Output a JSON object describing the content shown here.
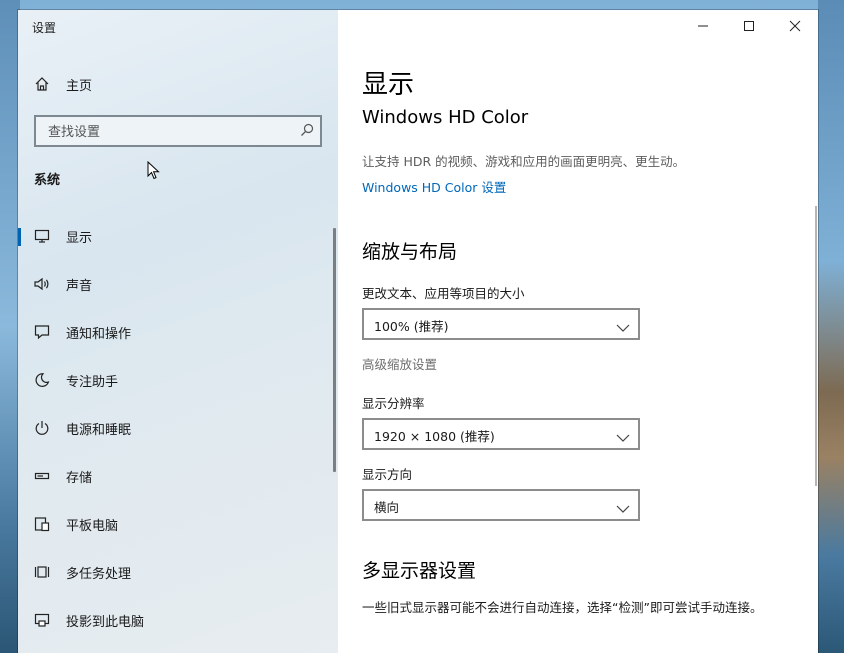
{
  "window": {
    "title": "设置",
    "controls": {
      "minimize": "minimize-icon",
      "maximize": "maximize-icon",
      "close": "close-icon"
    }
  },
  "sidebar": {
    "home_label": "主页",
    "search_placeholder": "查找设置",
    "section_label": "系统",
    "items": [
      {
        "label": "显示",
        "icon": "monitor-icon",
        "active": true
      },
      {
        "label": "声音",
        "icon": "speaker-icon"
      },
      {
        "label": "通知和操作",
        "icon": "notification-icon"
      },
      {
        "label": "专注助手",
        "icon": "moon-icon"
      },
      {
        "label": "电源和睡眠",
        "icon": "power-icon"
      },
      {
        "label": "存储",
        "icon": "storage-icon"
      },
      {
        "label": "平板电脑",
        "icon": "tablet-icon"
      },
      {
        "label": "多任务处理",
        "icon": "multitask-icon"
      },
      {
        "label": "投影到此电脑",
        "icon": "project-icon"
      }
    ]
  },
  "main": {
    "title": "显示",
    "hdr": {
      "title": "Windows HD Color",
      "description": "让支持 HDR 的视频、游戏和应用的画面更明亮、更生动。",
      "link": "Windows HD Color 设置"
    },
    "scale_layout": {
      "heading": "缩放与布局",
      "text_size_label": "更改文本、应用等项目的大小",
      "text_size_value": "100% (推荐)",
      "advanced_link": "高级缩放设置",
      "resolution_label": "显示分辨率",
      "resolution_value": "1920 × 1080 (推荐)",
      "orientation_label": "显示方向",
      "orientation_value": "横向"
    },
    "multi_display": {
      "heading": "多显示器设置",
      "description": "一些旧式显示器可能不会进行自动连接，选择“检测”即可尝试手动连接。"
    }
  },
  "colors": {
    "accent": "#0063b1",
    "link": "#0067b8"
  }
}
